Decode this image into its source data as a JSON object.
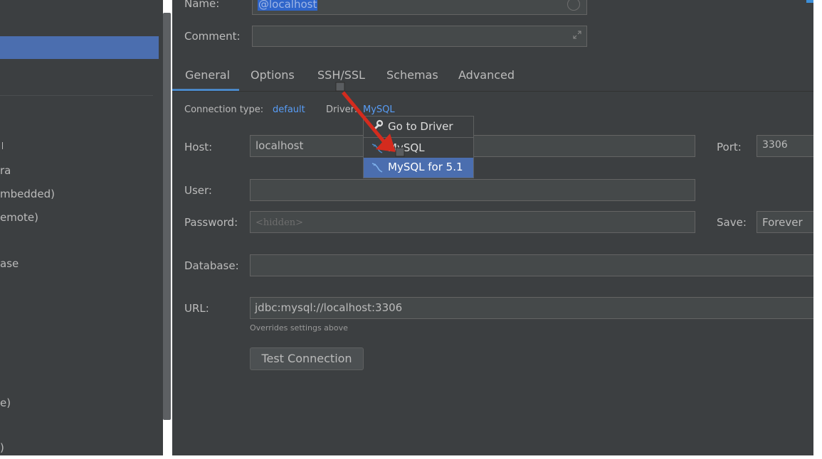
{
  "sidebar": {
    "items": [
      {
        "label": "ra"
      },
      {
        "label": "mbedded)"
      },
      {
        "label": "emote)"
      },
      {
        "label": "ase"
      },
      {
        "label": "e)"
      },
      {
        "label": ")"
      }
    ]
  },
  "form": {
    "name_label": "Name:",
    "name_value": "@localhost",
    "comment_label": "Comment:",
    "comment_value": "",
    "host_label": "Host:",
    "host_value": "localhost",
    "port_label": "Port:",
    "port_value": "3306",
    "user_label": "User:",
    "user_value": "",
    "password_label": "Password:",
    "password_placeholder": "<hidden>",
    "save_label": "Save:",
    "save_value": "Forever",
    "database_label": "Database:",
    "database_value": "",
    "url_label": "URL:",
    "url_value": "jdbc:mysql://localhost:3306",
    "url_hint": "Overrides settings above",
    "test_button": "Test Connection"
  },
  "tabs": [
    {
      "label": "General",
      "active": true
    },
    {
      "label": "Options"
    },
    {
      "label": "SSH/SSL"
    },
    {
      "label": "Schemas"
    },
    {
      "label": "Advanced"
    }
  ],
  "connection": {
    "type_label": "Connection type:",
    "type_value": "default",
    "driver_label": "Driver:",
    "driver_value": "MySQL"
  },
  "driver_menu": {
    "items": [
      {
        "label": "Go to Driver",
        "icon": "wrench-icon"
      },
      {
        "label": "MySQL",
        "icon": "mysql-dolphin-icon"
      },
      {
        "label": "MySQL for 5.1",
        "icon": "mysql-dolphin-icon",
        "selected": true
      }
    ]
  },
  "colors": {
    "background": "#3c3f41",
    "selection": "#4b6eaf",
    "link": "#589df6",
    "annotation_arrow": "#d42b1e"
  }
}
